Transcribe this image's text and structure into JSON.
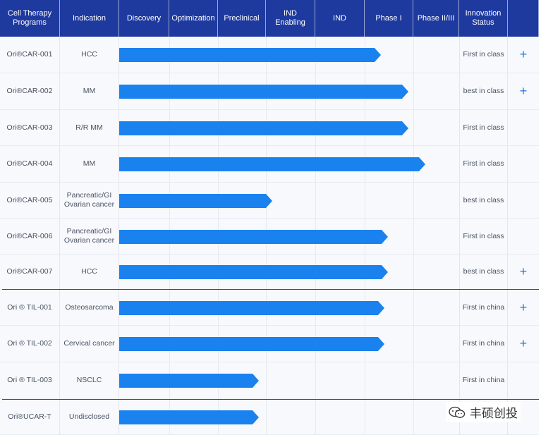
{
  "header": {
    "columns": [
      "Cell Therapy\nPrograms",
      "Indication",
      "Discovery",
      "Optimization",
      "Preclinical",
      "IND\nEnabling",
      "IND",
      "Phase I",
      "Phase II/III",
      "Innovation\nStatus",
      ""
    ]
  },
  "rows": [
    {
      "program": "Ori®CAR-001",
      "indication": "HCC",
      "progress_end_stage": "IND",
      "status": "First in class",
      "expand": "+"
    },
    {
      "program": "Ori®CAR-002",
      "indication": "MM",
      "progress_end_stage": "IND",
      "status": "best in class",
      "expand": "+"
    },
    {
      "program": "Ori®CAR-003",
      "indication": "R/R MM",
      "progress_end_stage": "IND",
      "status": "First in class",
      "expand": ""
    },
    {
      "program": "Ori®CAR-004",
      "indication": "MM",
      "progress_end_stage": "IND",
      "status": "First in class",
      "expand": ""
    },
    {
      "program": "Ori®CAR-005",
      "indication": "Pancreatic/GI\nOvarian cancer",
      "progress_end_stage": "Preclinical",
      "status": "best in class",
      "expand": ""
    },
    {
      "program": "Ori®CAR-006",
      "indication": "Pancreatic/GI\nOvarian cancer",
      "progress_end_stage": "IND",
      "status": "First in class",
      "expand": ""
    },
    {
      "program": "Ori®CAR-007",
      "indication": "HCC",
      "progress_end_stage": "IND",
      "status": "best in class",
      "expand": "+"
    },
    {
      "program": "Ori ® TIL-001",
      "indication": "Osteosarcoma",
      "progress_end_stage": "IND",
      "status": "First in china",
      "expand": "+"
    },
    {
      "program": "Ori ® TIL-002",
      "indication": "Cervical cancer",
      "progress_end_stage": "IND",
      "status": "First in china",
      "expand": "+"
    },
    {
      "program": "Ori ® TIL-003",
      "indication": "NSCLC",
      "progress_end_stage": "Preclinical",
      "status": "First in china",
      "expand": ""
    },
    {
      "program": "Ori®UCAR-T",
      "indication": "Undisclosed",
      "progress_end_stage": "Preclinical",
      "status": "",
      "expand": ""
    }
  ],
  "progress_fraction": [
    0.77,
    0.85,
    0.85,
    0.9,
    0.45,
    0.79,
    0.79,
    0.78,
    0.78,
    0.41,
    0.41
  ],
  "colors": {
    "header": "#1e3a9e",
    "bar": "#1a82ef",
    "plus": "#2e7be6",
    "row": "#f7f9fc"
  },
  "watermark": {
    "text": "丰硕创投",
    "icon": "wechat-icon"
  }
}
